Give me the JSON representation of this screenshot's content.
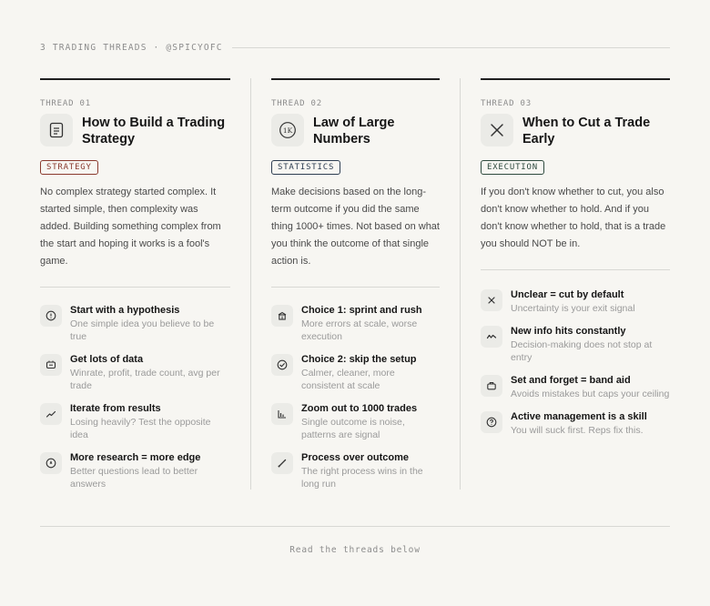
{
  "header": {
    "label": "3 TRADING THREADS · @SPICYOFC"
  },
  "threads": [
    {
      "num": "THREAD 01",
      "title": "How to Build a Trading Strategy",
      "icon": "document-icon",
      "tag": "STRATEGY",
      "tag_color": "#8a3a2e",
      "desc": "No complex strategy started complex. It started simple, then complexity was added. Building something complex from the start and hoping it works is a fool's game.",
      "items": [
        {
          "title": "Start with a hypothesis",
          "sub": "One simple idea you believe to be true",
          "icon": "alert-circle-icon"
        },
        {
          "title": "Get lots of data",
          "sub": "Winrate, profit, trade count, avg per trade",
          "icon": "database-icon"
        },
        {
          "title": "Iterate from results",
          "sub": "Losing heavily? Test the opposite idea",
          "icon": "trend-up-icon"
        },
        {
          "title": "More research = more edge",
          "sub": "Better questions lead to better answers",
          "icon": "compass-icon"
        }
      ]
    },
    {
      "num": "THREAD 02",
      "title": "Law of Large Numbers",
      "icon": "1k-badge-icon",
      "icon_text": "1K",
      "tag": "STATISTICS",
      "tag_color": "#2e3e52",
      "desc": "Make decisions based on the long-term outcome if you did the same thing 1000+ times. Not based on what you think the outcome of that single action is.",
      "items": [
        {
          "title": "Choice 1: sprint and rush",
          "sub": "More errors at scale, worse execution",
          "icon": "bank-icon"
        },
        {
          "title": "Choice 2: skip the setup",
          "sub": "Calmer, cleaner, more consistent at scale",
          "icon": "check-circle-icon"
        },
        {
          "title": "Zoom out to 1000 trades",
          "sub": "Single outcome is noise, patterns are signal",
          "icon": "bar-chart-icon"
        },
        {
          "title": "Process over outcome",
          "sub": "The right process wins in the long run",
          "icon": "diagonal-line-icon"
        }
      ]
    },
    {
      "num": "THREAD 03",
      "title": "When to Cut a Trade Early",
      "icon": "close-icon",
      "tag": "EXECUTION",
      "tag_color": "#2e4a3e",
      "desc": "If you don't know whether to cut, you also don't know whether to hold. And if you don't know whether to hold, that is a trade you should NOT be in.",
      "items": [
        {
          "title": "Unclear = cut by default",
          "sub": "Uncertainty is your exit signal",
          "icon": "close-small-icon"
        },
        {
          "title": "New info hits constantly",
          "sub": "Decision-making does not stop at entry",
          "icon": "wave-icon"
        },
        {
          "title": "Set and forget = band aid",
          "sub": "Avoids mistakes but caps your ceiling",
          "icon": "briefcase-icon"
        },
        {
          "title": "Active management is a skill",
          "sub": "You will suck first. Reps fix this.",
          "icon": "help-circle-icon"
        }
      ]
    }
  ],
  "footer": {
    "text": "Read the threads below"
  }
}
